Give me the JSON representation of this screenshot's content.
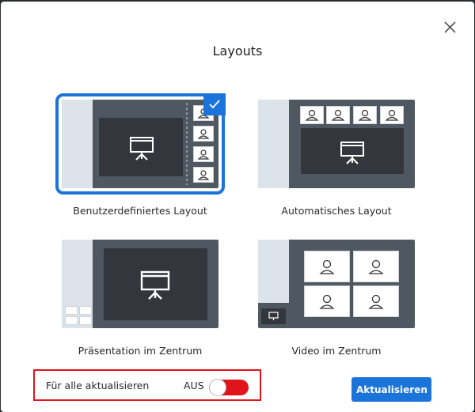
{
  "dialog": {
    "title": "Layouts",
    "close_label": "close"
  },
  "layouts": [
    {
      "id": "custom",
      "label": "Benutzerdefiniertes Layout",
      "selected": true
    },
    {
      "id": "automatic",
      "label": "Automatisches Layout",
      "selected": false
    },
    {
      "id": "presentation_center",
      "label": "Präsentation im Zentrum",
      "selected": false
    },
    {
      "id": "video_center",
      "label": "Video im Zentrum",
      "selected": false
    }
  ],
  "footer": {
    "update_all_label": "Für alle aktualisieren",
    "toggle_state": "AUS",
    "toggle_on": false,
    "update_button": "Aktualisieren"
  },
  "colors": {
    "accent": "#1a74d9",
    "toggle_off": "#e1141c",
    "highlight": "#e1141c"
  }
}
